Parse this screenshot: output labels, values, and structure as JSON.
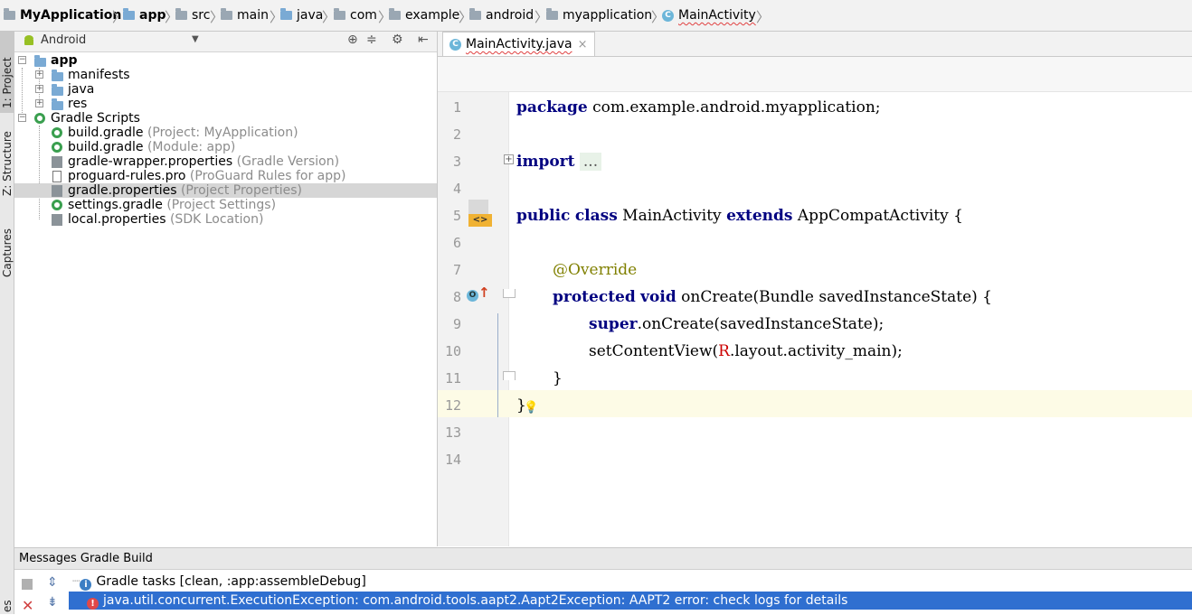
{
  "breadcrumb": [
    {
      "label": "MyApplication",
      "icon": "folder-icon",
      "bold": true
    },
    {
      "label": "app",
      "icon": "folder-icon",
      "bold": true
    },
    {
      "label": "src",
      "icon": "folder-icon"
    },
    {
      "label": "main",
      "icon": "folder-icon"
    },
    {
      "label": "java",
      "icon": "folder-icon"
    },
    {
      "label": "com",
      "icon": "folder-icon"
    },
    {
      "label": "example",
      "icon": "folder-icon"
    },
    {
      "label": "android",
      "icon": "folder-icon"
    },
    {
      "label": "myapplication",
      "icon": "folder-icon"
    },
    {
      "label": "MainActivity",
      "icon": "class-icon"
    }
  ],
  "left_stripe": {
    "project": "1: Project",
    "structure": "Z: Structure",
    "captures": "Captures",
    "bottom": "es"
  },
  "project_panel": {
    "view_selector": "Android",
    "tree": [
      {
        "label": "app",
        "hint": "",
        "icon": "module-folder-icon",
        "bold": true
      },
      {
        "label": "manifests",
        "hint": "",
        "icon": "folder-icon"
      },
      {
        "label": "java",
        "hint": "",
        "icon": "folder-icon"
      },
      {
        "label": "res",
        "hint": "",
        "icon": "folder-icon"
      },
      {
        "label": "Gradle Scripts",
        "hint": "",
        "icon": "gradle-icon"
      },
      {
        "label": "build.gradle",
        "hint": "(Project: MyApplication)",
        "icon": "gradle-icon"
      },
      {
        "label": "build.gradle",
        "hint": "(Module: app)",
        "icon": "gradle-icon"
      },
      {
        "label": "gradle-wrapper.properties",
        "hint": "(Gradle Version)",
        "icon": "properties-icon"
      },
      {
        "label": "proguard-rules.pro",
        "hint": "(ProGuard Rules for app)",
        "icon": "file-icon"
      },
      {
        "label": "gradle.properties",
        "hint": "(Project Properties)",
        "icon": "properties-icon",
        "selected": true
      },
      {
        "label": "settings.gradle",
        "hint": "(Project Settings)",
        "icon": "gradle-icon"
      },
      {
        "label": "local.properties",
        "hint": "(SDK Location)",
        "icon": "properties-icon"
      }
    ]
  },
  "editor": {
    "tab_label": "MainActivity.java",
    "line_numbers": [
      "1",
      "2",
      "3",
      "4",
      "5",
      "6",
      "7",
      "8",
      "9",
      "10",
      "11",
      "12",
      "13",
      "14"
    ],
    "code": {
      "l1_kw": "package",
      "l1_rest": " com.example.android.myapplication;",
      "l3_kw": "import",
      "l3_fold": "...",
      "l6_kw1": "public",
      "l6_kw2": "class",
      "l6_name": " MainActivity ",
      "l6_kw3": "extends",
      "l6_rest": " AppCompatActivity {",
      "l8_ann": "@Override",
      "l9_kw1": "protected",
      "l9_kw2": "void",
      "l9_rest": " onCreate(Bundle savedInstanceState) {",
      "l10_kw": "super",
      "l10_rest": ".onCreate(savedInstanceState);",
      "l11_pre": "setContentView(",
      "l11_r": "R",
      "l11_rest": ".layout.activity_main);",
      "l12": "}",
      "l13": "}"
    }
  },
  "messages": {
    "title": "Messages Gradle Build",
    "rows": [
      {
        "text": "Gradle tasks [clean, :app:assembleDebug]",
        "icon": "info-icon"
      },
      {
        "text": "java.util.concurrent.ExecutionException: com.android.tools.aapt2.Aapt2Exception: AAPT2 error: check logs for details",
        "icon": "error-icon",
        "selected": true
      }
    ]
  },
  "colors": {
    "keyword": "#000080",
    "annotation": "#808000",
    "selection": "#2f6fd0",
    "current_line": "#fdfbe6",
    "gradle": "#3a9f4f"
  }
}
